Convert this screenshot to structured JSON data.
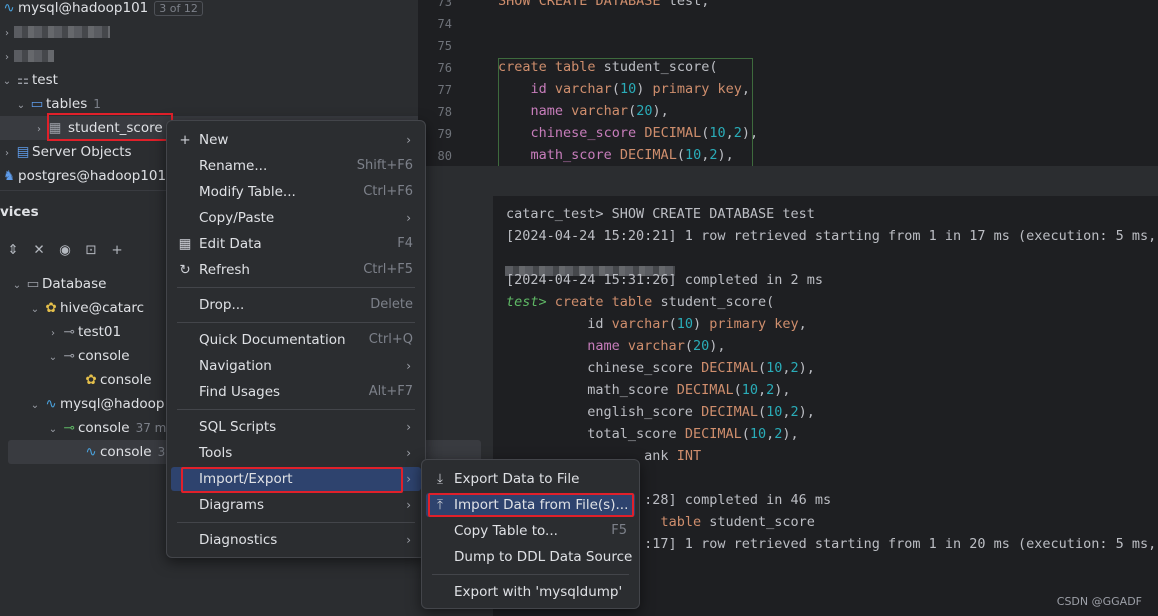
{
  "tree_top": {
    "mysql_conn": "mysql@hadoop101",
    "mysql_badge": "3 of 12",
    "test_db": "test",
    "tables_label": "tables",
    "tables_count": "1",
    "student_score": "student_score",
    "server_objects": "Server Objects",
    "postgres_conn": "postgres@hadoop101"
  },
  "services": {
    "title": "vices",
    "tree": {
      "database": "Database",
      "hive": "hive@catarc",
      "test01": "test01",
      "console1": "console",
      "console1_child": "console",
      "mysql": "mysql@hadoop1",
      "console2": "console",
      "console2_meta": "37 m",
      "console2_child": "console",
      "console2_child_meta": "3"
    }
  },
  "editor": {
    "lines": [
      {
        "n": "73",
        "segments": [
          {
            "t": "SHOW CREATE DATABASE ",
            "c": "kw"
          },
          {
            "t": "test;",
            "c": "plain"
          }
        ]
      },
      {
        "n": "74",
        "segments": []
      },
      {
        "n": "75",
        "segments": []
      },
      {
        "n": "76",
        "segments": [
          {
            "t": "create table ",
            "c": "kw"
          },
          {
            "t": "student_score(",
            "c": "plain"
          }
        ]
      },
      {
        "n": "77",
        "segments": [
          {
            "t": "    ",
            "c": "plain"
          },
          {
            "t": "id ",
            "c": "id"
          },
          {
            "t": "varchar",
            "c": "kw"
          },
          {
            "t": "(",
            "c": "plain"
          },
          {
            "t": "10",
            "c": "num"
          },
          {
            "t": ") ",
            "c": "plain"
          },
          {
            "t": "primary key",
            "c": "kw"
          },
          {
            "t": ",",
            "c": "plain"
          }
        ]
      },
      {
        "n": "78",
        "segments": [
          {
            "t": "    ",
            "c": "plain"
          },
          {
            "t": "name ",
            "c": "id"
          },
          {
            "t": "varchar",
            "c": "kw"
          },
          {
            "t": "(",
            "c": "plain"
          },
          {
            "t": "20",
            "c": "num"
          },
          {
            "t": "),",
            "c": "plain"
          }
        ]
      },
      {
        "n": "79",
        "segments": [
          {
            "t": "    ",
            "c": "plain"
          },
          {
            "t": "chinese_score ",
            "c": "id"
          },
          {
            "t": "DECIMAL",
            "c": "kw"
          },
          {
            "t": "(",
            "c": "plain"
          },
          {
            "t": "10",
            "c": "num"
          },
          {
            "t": ",",
            "c": "plain"
          },
          {
            "t": "2",
            "c": "num"
          },
          {
            "t": "),",
            "c": "plain"
          }
        ]
      },
      {
        "n": "80",
        "segments": [
          {
            "t": "    ",
            "c": "plain"
          },
          {
            "t": "math_score ",
            "c": "id"
          },
          {
            "t": "DECIMAL",
            "c": "kw"
          },
          {
            "t": "(",
            "c": "plain"
          },
          {
            "t": "10",
            "c": "num"
          },
          {
            "t": ",",
            "c": "plain"
          },
          {
            "t": "2",
            "c": "num"
          },
          {
            "t": "),",
            "c": "plain"
          }
        ]
      }
    ]
  },
  "console": {
    "lines": [
      {
        "segments": [
          {
            "t": "catarc_test> SHOW CREATE DATABASE test",
            "c": "plain"
          }
        ]
      },
      {
        "segments": [
          {
            "t": "[2024-04-24 15:20:21] 1 row retrieved starting from 1 in 17 ms (execution: 5 ms, f",
            "c": "plain"
          }
        ]
      },
      {
        "segments": []
      },
      {
        "segments": [
          {
            "t": "[2024-04-24 15:31:26] completed in 2 ms",
            "c": "plain"
          }
        ]
      },
      {
        "segments": [
          {
            "t": "test> ",
            "c": "prompt"
          },
          {
            "t": "create table ",
            "c": "kw"
          },
          {
            "t": "student_score(",
            "c": "plain"
          }
        ]
      },
      {
        "segments": [
          {
            "t": "          id ",
            "c": "plain"
          },
          {
            "t": "varchar",
            "c": "kw"
          },
          {
            "t": "(",
            "c": "plain"
          },
          {
            "t": "10",
            "c": "num"
          },
          {
            "t": ") ",
            "c": "plain"
          },
          {
            "t": "primary key",
            "c": "kw"
          },
          {
            "t": ",",
            "c": "plain"
          }
        ]
      },
      {
        "segments": [
          {
            "t": "          ",
            "c": "plain"
          },
          {
            "t": "name ",
            "c": "id"
          },
          {
            "t": "varchar",
            "c": "kw"
          },
          {
            "t": "(",
            "c": "plain"
          },
          {
            "t": "20",
            "c": "num"
          },
          {
            "t": "),",
            "c": "plain"
          }
        ]
      },
      {
        "segments": [
          {
            "t": "          chinese_score ",
            "c": "plain"
          },
          {
            "t": "DECIMAL",
            "c": "kw"
          },
          {
            "t": "(",
            "c": "plain"
          },
          {
            "t": "10",
            "c": "num"
          },
          {
            "t": ",",
            "c": "plain"
          },
          {
            "t": "2",
            "c": "num"
          },
          {
            "t": "),",
            "c": "plain"
          }
        ]
      },
      {
        "segments": [
          {
            "t": "          math_score ",
            "c": "plain"
          },
          {
            "t": "DECIMAL",
            "c": "kw"
          },
          {
            "t": "(",
            "c": "plain"
          },
          {
            "t": "10",
            "c": "num"
          },
          {
            "t": ",",
            "c": "plain"
          },
          {
            "t": "2",
            "c": "num"
          },
          {
            "t": "),",
            "c": "plain"
          }
        ]
      },
      {
        "segments": [
          {
            "t": "          english_score ",
            "c": "plain"
          },
          {
            "t": "DECIMAL",
            "c": "kw"
          },
          {
            "t": "(",
            "c": "plain"
          },
          {
            "t": "10",
            "c": "num"
          },
          {
            "t": ",",
            "c": "plain"
          },
          {
            "t": "2",
            "c": "num"
          },
          {
            "t": "),",
            "c": "plain"
          }
        ]
      },
      {
        "segments": [
          {
            "t": "          total_score ",
            "c": "plain"
          },
          {
            "t": "DECIMAL",
            "c": "kw"
          },
          {
            "t": "(",
            "c": "plain"
          },
          {
            "t": "10",
            "c": "num"
          },
          {
            "t": ",",
            "c": "plain"
          },
          {
            "t": "2",
            "c": "num"
          },
          {
            "t": "),",
            "c": "plain"
          }
        ]
      },
      {
        "segments": [
          {
            "t": "                 ank ",
            "c": "plain"
          },
          {
            "t": "INT",
            "c": "kw"
          }
        ]
      },
      {
        "segments": []
      },
      {
        "segments": [
          {
            "t": "                 :28] completed in 46 ms",
            "c": "plain"
          }
        ]
      },
      {
        "segments": [
          {
            "t": "                   ",
            "c": "plain"
          },
          {
            "t": "table ",
            "c": "kw"
          },
          {
            "t": "student_score",
            "c": "plain"
          }
        ]
      },
      {
        "segments": [
          {
            "t": "                 :17] 1 row retrieved starting from 1 in 20 ms (execution: 5 ms, f",
            "c": "plain"
          }
        ]
      }
    ]
  },
  "context_menu": {
    "new": "New",
    "rename": "Rename...",
    "rename_sc": "Shift+F6",
    "modify": "Modify Table...",
    "modify_sc": "Ctrl+F6",
    "copy_paste": "Copy/Paste",
    "edit_data": "Edit Data",
    "edit_data_sc": "F4",
    "refresh": "Refresh",
    "refresh_sc": "Ctrl+F5",
    "drop": "Drop...",
    "drop_sc": "Delete",
    "quick_doc": "Quick Documentation",
    "quick_doc_sc": "Ctrl+Q",
    "navigation": "Navigation",
    "find_usages": "Find Usages",
    "find_usages_sc": "Alt+F7",
    "sql_scripts": "SQL Scripts",
    "tools": "Tools",
    "import_export": "Import/Export",
    "diagrams": "Diagrams",
    "diagnostics": "Diagnostics"
  },
  "submenu": {
    "export_file": "Export Data to File",
    "import_file": "Import Data from File(s)...",
    "copy_table": "Copy Table to...",
    "copy_table_sc": "F5",
    "dump_ddl": "Dump to DDL Data Source",
    "export_mysqldump": "Export with 'mysqldump'"
  },
  "watermark": "CSDN @GGADF"
}
